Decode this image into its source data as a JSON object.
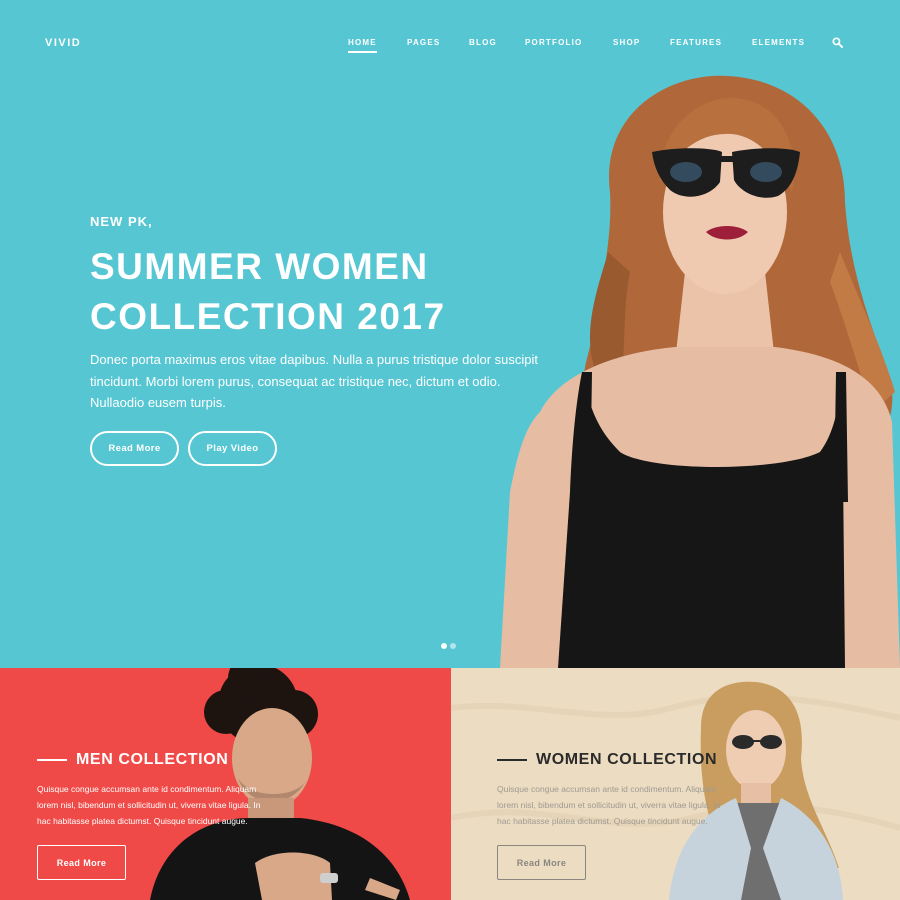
{
  "brand": {
    "logo": "VIVID"
  },
  "nav": {
    "items": [
      {
        "label": "HOME",
        "active": true
      },
      {
        "label": "PAGES",
        "active": false
      },
      {
        "label": "BLOG",
        "active": false
      },
      {
        "label": "PORTFOLIO",
        "active": false
      },
      {
        "label": "SHOP",
        "active": false
      },
      {
        "label": "FEATURES",
        "active": false
      },
      {
        "label": "ELEMENTS",
        "active": false
      }
    ],
    "search_icon": "search-icon"
  },
  "hero": {
    "kicker": "NEW PK,",
    "headline_line1": "SUMMER WOMEN",
    "headline_line2": "COLLECTION 2017",
    "body_line1": "Donec porta maximus eros vitae dapibus. Nulla a purus tristique dolor suscipit",
    "body_line2": "tincidunt. Morbi lorem purus, consequat ac tristique nec, dictum et odio.",
    "body_line3": "Nullaodio eusem turpis.",
    "read_more_label": "Read More",
    "play_video_label": "Play Video",
    "slider": {
      "count": 2,
      "active_index": 0
    },
    "background_color": "#56c6d3"
  },
  "promos": {
    "men": {
      "title": "MEN COLLECTION",
      "line1": "Quisque congue accumsan ante id condimentum. Aliquam",
      "line2": "lorem nisl, bibendum et sollicitudin ut, viverra vitae ligula. In",
      "line3": "hac habitasse platea dictumst. Quisque tincidunt augue.",
      "button_label": "Read More",
      "background_color": "#ef4a47"
    },
    "women": {
      "title": "WOMEN COLLECTION",
      "line1": "Quisque congue accumsan ante id condimentum. Aliquam",
      "line2": "lorem nisl, bibendum et sollicitudin ut, viverra vitae ligula. In",
      "line3": "hac habitasse platea dictumst. Quisque tincidunt augue.",
      "button_label": "Read More",
      "background_color": "#ecdcc2"
    }
  }
}
